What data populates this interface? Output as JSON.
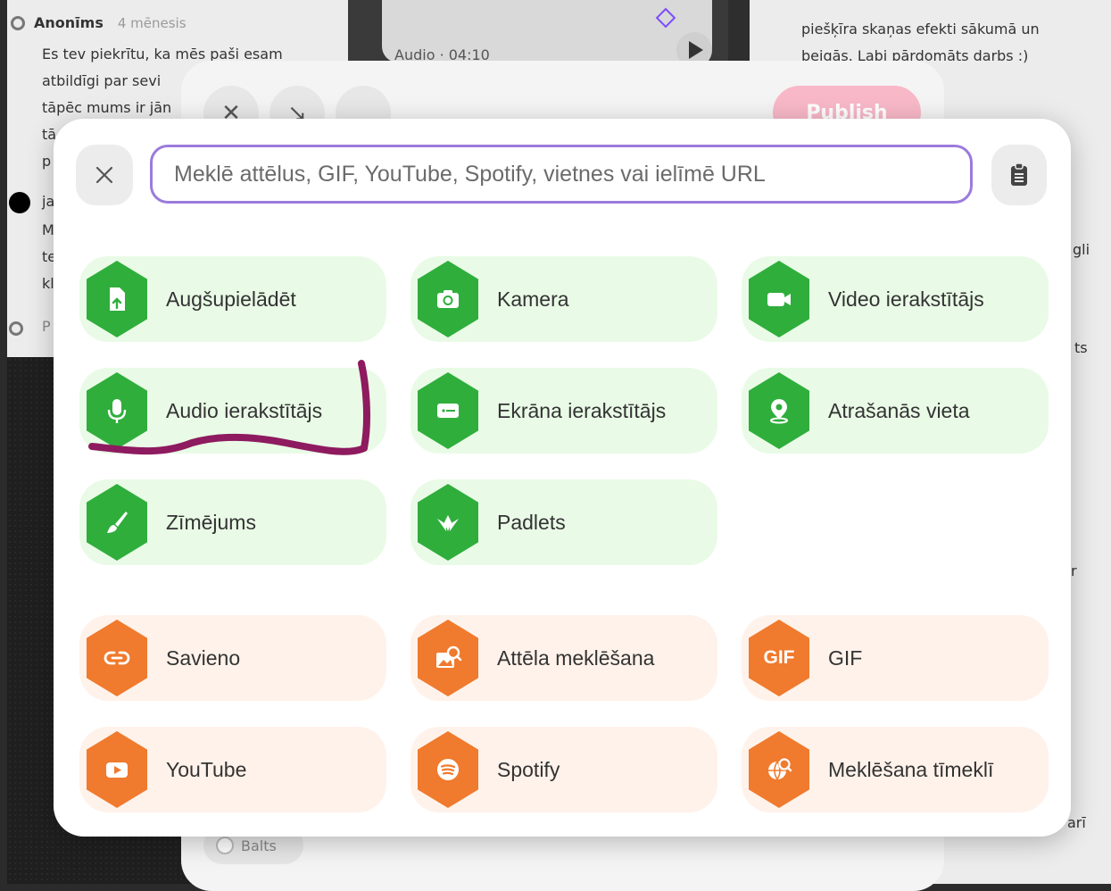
{
  "background": {
    "comment1": {
      "author": "Anonīms",
      "age": "4 mēnesis",
      "lines": [
        "Es tev piekrītu, ka mēs paši esam",
        "atbildīgi par sevi",
        "tāpēc mums ir jān",
        "tā",
        "p"
      ]
    },
    "comment2": {
      "author_fragment": "ja",
      "lines": [
        "M",
        "te",
        "kl"
      ]
    },
    "footer_fragment": "P",
    "audio_label": "Audio · 04:10",
    "right_text": [
      "piešķīra skaņas efekti sākumā un",
      "beigās. Labi pārdomāts darbs :)"
    ],
    "right_fragments": [
      "gli",
      "ts",
      "r",
      "arī"
    ],
    "publish_label": "Publish",
    "balts_label": "Balts"
  },
  "search": {
    "placeholder": "Meklē attēlus, GIF, YouTube, Spotify, vietnes vai ielīmē URL"
  },
  "tiles_green": [
    {
      "label": "Augšupielādēt",
      "icon": "upload-file-icon"
    },
    {
      "label": "Kamera",
      "icon": "camera-icon"
    },
    {
      "label": "Video ierakstītājs",
      "icon": "video-camera-icon"
    },
    {
      "label": "Audio ierakstītājs",
      "icon": "microphone-icon"
    },
    {
      "label": "Ekrāna ierakstītājs",
      "icon": "screen-record-icon"
    },
    {
      "label": "Atrašanās vieta",
      "icon": "location-pin-icon"
    },
    {
      "label": "Zīmējums",
      "icon": "brush-icon"
    },
    {
      "label": "Padlets",
      "icon": "padlet-logo-icon"
    }
  ],
  "tiles_orange": [
    {
      "label": "Savieno",
      "icon": "link-icon"
    },
    {
      "label": "Attēla meklēšana",
      "icon": "image-search-icon"
    },
    {
      "label": "GIF",
      "icon": "gif-icon",
      "icon_text": "GIF"
    },
    {
      "label": "YouTube",
      "icon": "youtube-icon"
    },
    {
      "label": "Spotify",
      "icon": "spotify-icon"
    },
    {
      "label": "Meklēšana tīmeklī",
      "icon": "web-search-icon"
    }
  ],
  "colors": {
    "green_tile_bg": "#e9fbe6",
    "green_icon": "#2fae3c",
    "orange_tile_bg": "#fff2ea",
    "orange_icon": "#f07a2d",
    "search_border": "#9b7bdc",
    "annotation_stroke": "#8e1a5f"
  }
}
